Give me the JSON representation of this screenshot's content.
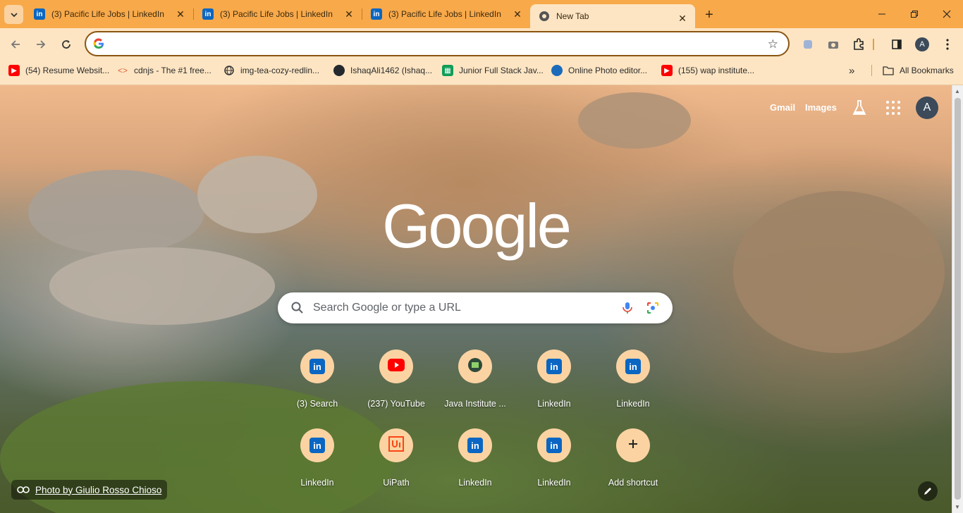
{
  "tabs": [
    {
      "title": "(3) Pacific Life Jobs | LinkedIn",
      "favicon": "linkedin-icon"
    },
    {
      "title": "(3) Pacific Life Jobs | LinkedIn",
      "favicon": "linkedin-icon"
    },
    {
      "title": "(3) Pacific Life Jobs | LinkedIn",
      "favicon": "linkedin-icon"
    },
    {
      "title": "New Tab",
      "favicon": "chrome-icon",
      "active": true
    }
  ],
  "omnibox": {
    "value": "",
    "placeholder": ""
  },
  "bookmarks": [
    {
      "label": "(54) Resume Websit...",
      "icon": "youtube-icon"
    },
    {
      "label": "cdnjs - The #1 free...",
      "icon": "cdnjs-icon"
    },
    {
      "label": "img-tea-cozy-redlin...",
      "icon": "web-icon"
    },
    {
      "label": "IshaqAli1462 (Ishaq...",
      "icon": "github-icon"
    },
    {
      "label": "Junior Full Stack Jav...",
      "icon": "sheets-icon"
    },
    {
      "label": "Online Photo editor...",
      "icon": "photopea-icon"
    },
    {
      "label": "(155) wap institute...",
      "icon": "youtube-icon"
    }
  ],
  "all_bookmarks_label": "All Bookmarks",
  "top_links": {
    "gmail": "Gmail",
    "images": "Images"
  },
  "account_initial": "A",
  "logo": "Google",
  "search": {
    "placeholder": "Search Google or type a URL"
  },
  "shortcuts": [
    {
      "label": "(3) Search",
      "icon": "linkedin-icon"
    },
    {
      "label": "(237) YouTube",
      "icon": "youtube-icon"
    },
    {
      "label": "Java Institute ...",
      "icon": "java-institute-icon"
    },
    {
      "label": "LinkedIn",
      "icon": "linkedin-icon"
    },
    {
      "label": "LinkedIn",
      "icon": "linkedin-icon"
    },
    {
      "label": "LinkedIn",
      "icon": "linkedin-icon"
    },
    {
      "label": "UiPath",
      "icon": "uipath-icon"
    },
    {
      "label": "LinkedIn",
      "icon": "linkedin-icon"
    },
    {
      "label": "LinkedIn",
      "icon": "linkedin-icon"
    },
    {
      "label": "Add shortcut",
      "icon": "plus-icon"
    }
  ],
  "attribution": "Photo by Giulio Rosso Chioso",
  "colors": {
    "tabstrip": "#f8a94a",
    "toolbar": "#fde5c3",
    "linkedin": "#0a66c2",
    "youtube": "#ff0000"
  }
}
